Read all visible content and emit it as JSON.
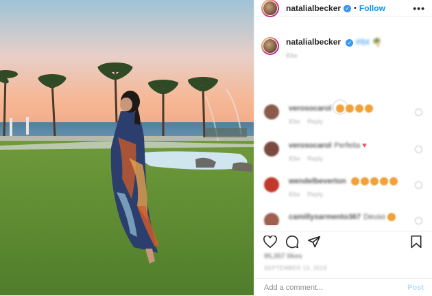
{
  "post": {
    "username": "natalialbecker",
    "follow_label": "Follow",
    "separator": "•",
    "more_label": "•••",
    "verified_glyph": "✓",
    "caption_tag": "#tbt",
    "caption_emoji": "🌴",
    "caption_time": "83w",
    "load_more_glyph": "+"
  },
  "comments": [
    {
      "user": "verosocarol",
      "text": "",
      "emoji_count": 4,
      "heart": false,
      "meta": "83w Reply",
      "avatar_color": "#8a5a4a"
    },
    {
      "user": "verosocarol",
      "text": "Perfeita",
      "emoji_count": 0,
      "heart": true,
      "meta": "83w Reply",
      "avatar_color": "#7a4a40"
    },
    {
      "user": "wendelbeverton",
      "text": "",
      "emoji_count": 5,
      "heart": false,
      "meta": "83w Reply",
      "avatar_color": "#c0392b"
    },
    {
      "user": "camillysarmento367",
      "text": "Deuso",
      "emoji_count": 1,
      "heart": false,
      "meta": "",
      "avatar_color": "#a06050"
    }
  ],
  "actions": {
    "like_icon": "heart-outline-icon",
    "comment_icon": "comment-bubble-icon",
    "share_icon": "paper-plane-icon",
    "save_icon": "bookmark-icon"
  },
  "likes_text": "95,357 likes",
  "date_text": "SEPTEMBER 13, 2019",
  "add_comment": {
    "placeholder": "Add a comment...",
    "post_label": "Post"
  },
  "colors": {
    "follow": "#0095f6",
    "verified": "#3897f0",
    "post_disabled": "#b2dffc",
    "border": "#efefef"
  }
}
